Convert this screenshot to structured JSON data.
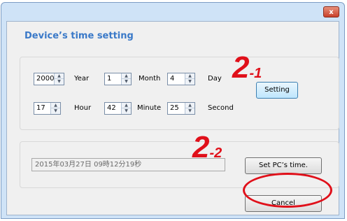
{
  "window": {
    "close_glyph": "x"
  },
  "dialog": {
    "heading": "Device’s time setting",
    "fields": {
      "year": {
        "value": "2000",
        "label": "Year"
      },
      "month": {
        "value": "1",
        "label": "Month"
      },
      "day": {
        "value": "4",
        "label": "Day"
      },
      "hour": {
        "value": "17",
        "label": "Hour"
      },
      "minute": {
        "value": "42",
        "label": "Minute"
      },
      "second": {
        "value": "25",
        "label": "Second"
      }
    },
    "setting_button": "Setting",
    "pc_time_display": "2015年03月27日 09時12分19秒",
    "set_pc_time_button": "Set PC’s time.",
    "cancel_button": "Cancel"
  },
  "annotations": {
    "step1_main": "2",
    "step1_sub": "-1",
    "step2_main": "2",
    "step2_sub": "-2",
    "color": "#e0101a"
  },
  "icons": {
    "spin_up": "up-arrow",
    "spin_down": "down-arrow",
    "close": "close-icon"
  }
}
